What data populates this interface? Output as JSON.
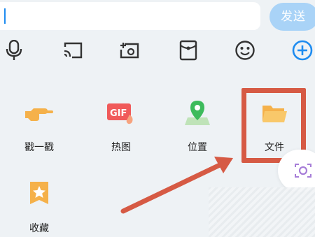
{
  "input": {
    "value": "",
    "placeholder": ""
  },
  "send_button": {
    "label": "发送"
  },
  "toolbar": {
    "icons": [
      "microphone-icon",
      "screen-cast-icon",
      "photo-icon",
      "red-packet-icon",
      "emoji-icon",
      "plus-icon"
    ]
  },
  "panel": {
    "items": [
      {
        "label": "戳一戳",
        "icon": "poke-hand-icon"
      },
      {
        "label": "热图",
        "icon": "gif-hot-image-icon"
      },
      {
        "label": "位置",
        "icon": "location-pin-icon"
      },
      {
        "label": "文件",
        "icon": "folder-icon"
      },
      {
        "label": "收藏",
        "icon": "favorites-star-icon"
      }
    ]
  },
  "colors": {
    "accent": "#1e8cf0",
    "send_button_bg": "#a9d3f7",
    "highlight": "#d65a44",
    "background": "#eef2f5"
  }
}
